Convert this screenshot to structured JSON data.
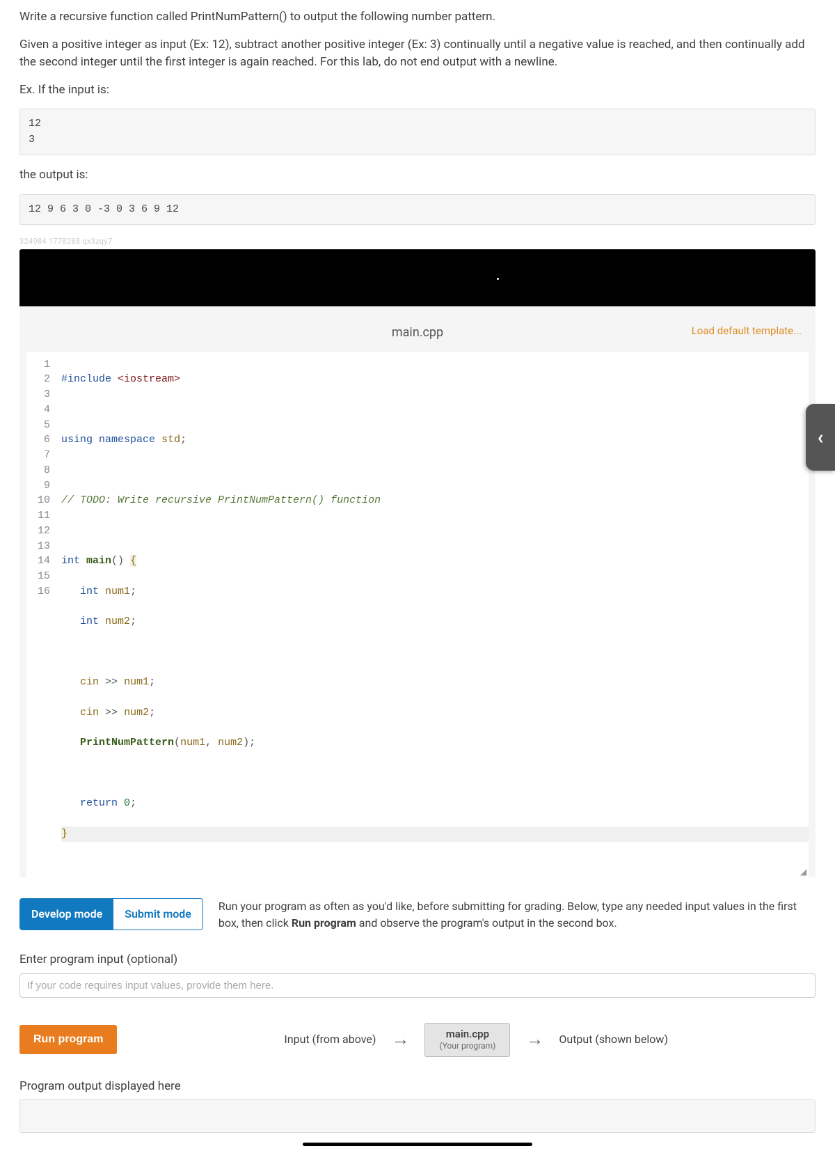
{
  "description": {
    "p1": "Write a recursive function called PrintNumPattern() to output the following number pattern.",
    "p2": "Given a positive integer as input (Ex: 12), subtract another positive integer (Ex: 3) continually until a negative value is reached, and then continually add the second integer until the first integer is again reached. For this lab, do not end output with a newline.",
    "p3": "Ex. If the input is:",
    "example_input": "12\n3",
    "p4": "the output is:",
    "example_output": "12 9 6 3 0 -3 0 3 6 9 12"
  },
  "watermark": "324984 1778288 qx3zqy7",
  "editor": {
    "filename": "main.cpp",
    "load_template": "Load default template...",
    "line_numbers": [
      "1",
      "2",
      "3",
      "4",
      "5",
      "6",
      "7",
      "8",
      "9",
      "10",
      "11",
      "12",
      "13",
      "14",
      "15",
      "16"
    ],
    "code": {
      "l1_include": "#include",
      "l1_header": "<iostream>",
      "l3_using": "using",
      "l3_namespace": "namespace",
      "l3_std": "std",
      "l5_comment": "// TODO: Write recursive PrintNumPattern() function",
      "l7_int": "int",
      "l7_main": "main",
      "l8_int": "int",
      "l8_num1": "num1",
      "l9_int": "int",
      "l9_num2": "num2",
      "l11_cin": "cin",
      "l11_num1": "num1",
      "l12_cin": "cin",
      "l12_num2": "num2",
      "l13_fn": "PrintNumPattern",
      "l13_arg1": "num1",
      "l13_arg2": "num2",
      "l15_return": "return",
      "l15_zero": "0"
    }
  },
  "modes": {
    "develop": "Develop mode",
    "submit": "Submit mode",
    "desc_pre": "Run your program as often as you'd like, before submitting for grading. Below, type any needed input values in the first box, then click ",
    "desc_bold": "Run program",
    "desc_post": " and observe the program's output in the second box."
  },
  "input_section": {
    "label": "Enter program input (optional)",
    "placeholder": "If your code requires input values, provide them here."
  },
  "run_row": {
    "run_button": "Run program",
    "input_label": "Input (from above)",
    "program_name": "main.cpp",
    "program_sub": "(Your program)",
    "output_label": "Output (shown below)"
  },
  "output_section": {
    "label": "Program output displayed here"
  }
}
